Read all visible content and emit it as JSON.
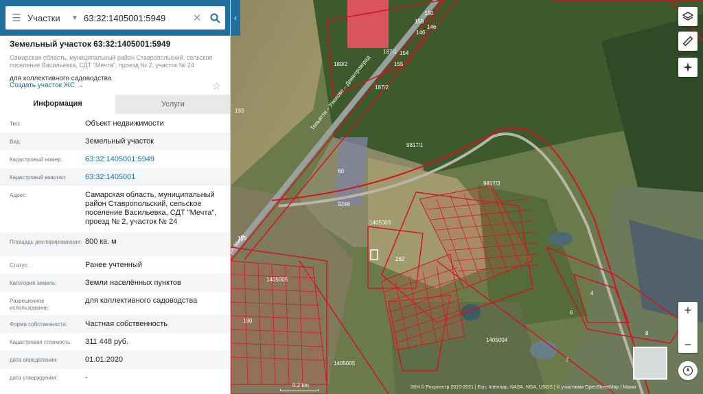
{
  "search": {
    "mode_label": "Участки",
    "query": "63:32:1405001:5949"
  },
  "plot": {
    "title": "Земельный участок 63:32:1405001:5949",
    "address_short": "Самарская область, муниципальный район Ставропольский, сельское поселение Васильевка, СДТ \"Мечта\", проезд № 2, участок № 24",
    "use": "для коллективного садоводства",
    "create_link": "Создать участок ЖС →"
  },
  "tabs": {
    "info": "Информация",
    "services": "Услуги"
  },
  "details": [
    {
      "key": "Тип:",
      "value": "Объект недвижимости"
    },
    {
      "key": "Вид:",
      "value": "Земельный участок"
    },
    {
      "key": "Кадастровый номер:",
      "value": "63:32:1405001:5949",
      "link": true
    },
    {
      "key": "Кадастровый квартал:",
      "value": "63:32:1405001",
      "link": true
    },
    {
      "key": "Адрес:",
      "value": "Самарская область, муниципальный район Ставропольский, сельское поселение Васильевка, СДТ \"Мечта\", проезд № 2, участок № 24"
    },
    {
      "key": "Площадь декларированная:",
      "value": "800 кв. м"
    },
    {
      "key": "Статус:",
      "value": "Ранее учтенный"
    },
    {
      "key": "Категория земель:",
      "value": "Земли населённых пунктов"
    },
    {
      "key": "Разрешенное использование:",
      "value": "для коллективного садоводства"
    },
    {
      "key": "Форма собственности:",
      "value": "Частная собственность"
    },
    {
      "key": "Кадастровая стоимость:",
      "value": "311 448 руб."
    },
    {
      "key": "дата определения:",
      "value": "01.01.2020"
    },
    {
      "key": "дата утверждения:",
      "value": "-"
    }
  ],
  "map": {
    "labels": [
      "189/2",
      "193",
      "9817/1",
      "9817/3",
      "60",
      "9246",
      "1405003",
      "262",
      "1405005",
      "1405004",
      "4",
      "6",
      "7",
      "8",
      "190",
      "1405005",
      "146",
      "146",
      "154",
      "155",
      "159",
      "150",
      "187/1",
      "187/2",
      "159"
    ],
    "road_labels": [
      "Тольятти – Узюково – Димитровград",
      "ул. Мира"
    ],
    "scale": "0.2 km",
    "attribution": "ЗКН © Росреестр 2010-2021 | Esri, Intermap, NASA, NGA, USGS | © участники OpenStreetMap | Maxar",
    "colors": {
      "boundary": "#d4141c",
      "forest": "#3f5a2c",
      "field": "#9c9565"
    }
  },
  "controls": {
    "zoom_in": "+",
    "zoom_out": "−"
  }
}
